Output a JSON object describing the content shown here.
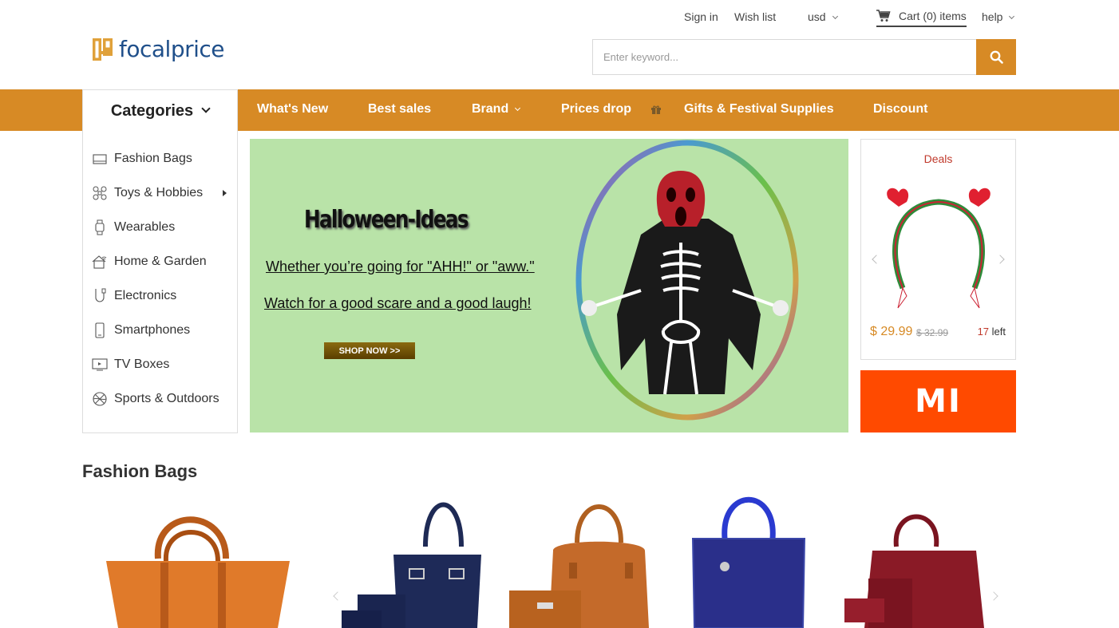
{
  "header": {
    "logo_text": "focalprice",
    "links": {
      "sign_in": "Sign in",
      "wish_list": "Wish list",
      "currency": "usd",
      "cart": "Cart (0) items",
      "help": "help"
    },
    "search_placeholder": "Enter keyword..."
  },
  "nav": {
    "categories_label": "Categories",
    "items": [
      "What's New",
      "Best sales",
      "Brand",
      "Prices drop",
      "Gifts & Festival Supplies",
      "Discount"
    ]
  },
  "categories": [
    {
      "label": "Fashion Bags",
      "icon": "bag-icon"
    },
    {
      "label": "Toys & Hobbies",
      "icon": "drone-icon"
    },
    {
      "label": "Wearables",
      "icon": "watch-icon"
    },
    {
      "label": "Home & Garden",
      "icon": "home-icon"
    },
    {
      "label": "Electronics",
      "icon": "cable-icon"
    },
    {
      "label": "Smartphones",
      "icon": "phone-icon"
    },
    {
      "label": "TV Boxes",
      "icon": "tv-icon"
    },
    {
      "label": "Sports & Outdoors",
      "icon": "ball-icon"
    }
  ],
  "banner": {
    "headline": "Halloween-Ideas",
    "line1": "Whether you’re going for \"AHH!\" or \"aww.\"",
    "line2": "Watch for a good scare and a good laugh!",
    "cta": "SHOP NOW >>"
  },
  "deals": {
    "title": "Deals",
    "price": "$ 29.99",
    "old_price": "$ 32.99",
    "stock_count": "17",
    "stock_label": "left"
  },
  "promo_brand": "MI",
  "section": {
    "title": "Fashion Bags"
  },
  "colors": {
    "accent": "#d78a25",
    "brand_blue": "#1f4f8a",
    "banner_bg": "#b9e3a8",
    "mi_orange": "#ff4a00",
    "deal_red": "#c0392b"
  }
}
